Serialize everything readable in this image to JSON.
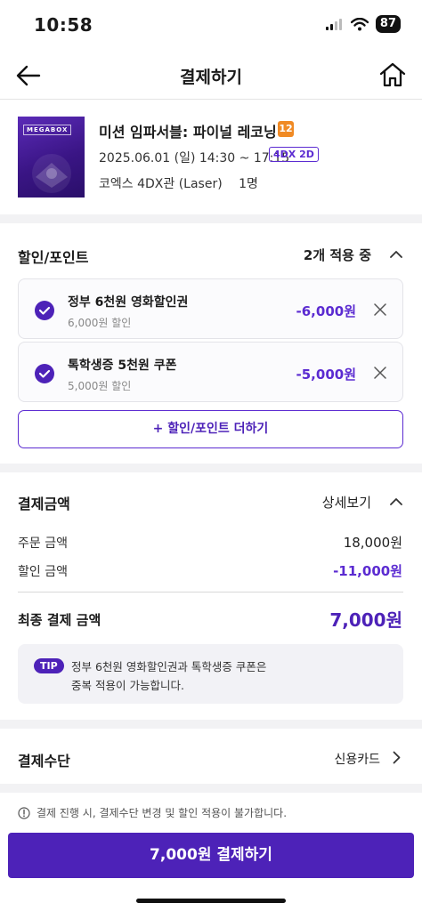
{
  "status_bar": {
    "time": "10:58",
    "battery": "87"
  },
  "header": {
    "title": "결제하기",
    "back_icon": "arrow-left-icon",
    "home_icon": "home-icon"
  },
  "movie": {
    "poster_logo": "MEGABOX",
    "title": "미션 임파서블: 파이널 레코닝",
    "age_rating": "12",
    "date_time": "2025.06.01 (일) 14:30 ~ 17:15",
    "format": "4DX 2D",
    "place": "코엑스 4DX관 (Laser)",
    "people": "1명"
  },
  "discount": {
    "title": "할인/포인트",
    "status": "2개 적용 중",
    "coupons": [
      {
        "name": "정부 6천원 영화할인권",
        "sub": "6,000원 할인",
        "amount": "-6,000원"
      },
      {
        "name": "톡학생증 5천원 쿠폰",
        "sub": "5,000원 할인",
        "amount": "-5,000원"
      }
    ],
    "add_label": "+ 할인/포인트 더하기"
  },
  "payment": {
    "title": "결제금액",
    "detail_label": "상세보기",
    "order_label": "주문 금액",
    "order_value": "18,000원",
    "discount_label": "할인 금액",
    "discount_value": "-11,000원",
    "final_label": "최종 결제 금액",
    "final_value": "7,000원",
    "tip_badge": "TIP",
    "tip_line1": "정부 6천원 영화할인권과 톡학생증 쿠폰은",
    "tip_line2": "중복 적용이 가능합니다."
  },
  "pay_method": {
    "title": "결제수단",
    "value": "신용카드"
  },
  "notice": "결제 진행 시, 결제수단 변경 및 할인 적용이 불가합니다.",
  "pay_button": "7,000원 결제하기",
  "colors": {
    "accent": "#4d22b8",
    "accent_text": "#5b2bd1",
    "age_badge": "#f08a24"
  }
}
